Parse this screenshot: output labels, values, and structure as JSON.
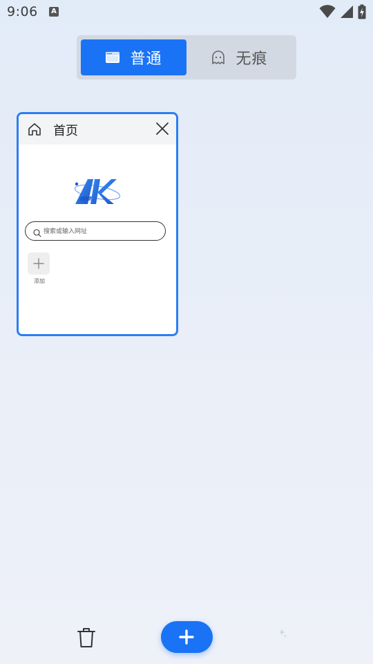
{
  "status_bar": {
    "time": "9:06",
    "notification_glyph": "A",
    "icons": [
      "wifi-icon",
      "cell-signal-icon",
      "battery-charging-icon"
    ]
  },
  "mode_switch": {
    "normal_label": "普通",
    "incognito_label": "无痕",
    "selected": "普通",
    "accent_color": "#1a73f4"
  },
  "tab_card": {
    "title": "首页",
    "logo_text": "AK",
    "search_placeholder": "搜索或输入网址",
    "add_label": "添加",
    "border_color": "#2a7ff2"
  },
  "bottom_bar": {
    "icons": [
      "trash-icon",
      "plus-icon"
    ]
  }
}
